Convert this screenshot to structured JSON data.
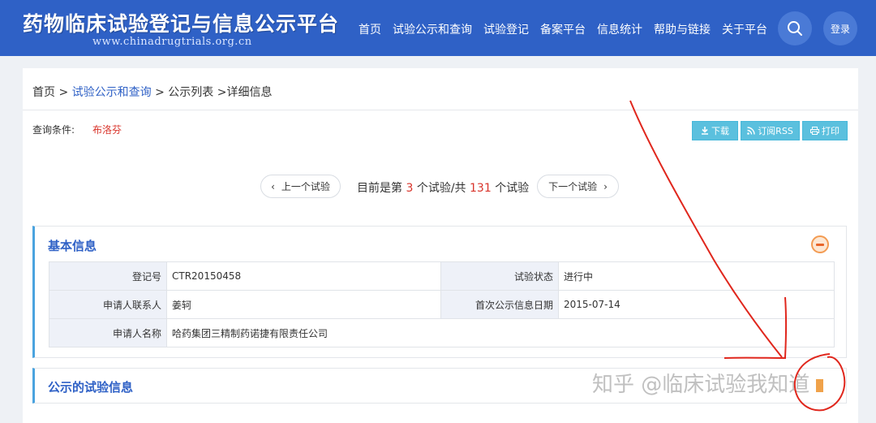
{
  "header": {
    "title": "药物临床试验登记与信息公示平台",
    "url_text": "www.chinadrugtrials.org.cn",
    "nav": [
      "首页",
      "试验公示和查询",
      "试验登记",
      "备案平台",
      "信息统计",
      "帮助与链接",
      "关于平台"
    ],
    "login_label": "登录",
    "accent_color": "#2f61c6"
  },
  "breadcrumb": {
    "home": "首页",
    "sep1": ">",
    "query": "试验公示和查询",
    "sep2": ">",
    "list": "公示列表",
    "sep3": ">",
    "detail": "详细信息"
  },
  "query": {
    "label": "查询条件:",
    "value": "布洛芬"
  },
  "toolbar": {
    "download": "下载",
    "rss": "订阅RSS",
    "print": "打印"
  },
  "pager": {
    "prev": "上一个试验",
    "next": "下一个试验",
    "prefix": "目前是第",
    "current": "3",
    "middle": "个试验/共",
    "total": "131",
    "suffix": "个试验"
  },
  "basic_info": {
    "title": "基本信息",
    "rows": [
      {
        "label1": "登记号",
        "value1": "CTR20150458",
        "label2": "试验状态",
        "value2": "进行中"
      },
      {
        "label1": "申请人联系人",
        "value1": "姜轲",
        "label2": "首次公示信息日期",
        "value2": "2015-07-14"
      },
      {
        "label1": "申请人名称",
        "value1": "哈药集团三精制药诺捷有限责任公司"
      }
    ]
  },
  "trial_info": {
    "title": "公示的试验信息"
  },
  "watermark": "知乎 @临床试验我知道"
}
